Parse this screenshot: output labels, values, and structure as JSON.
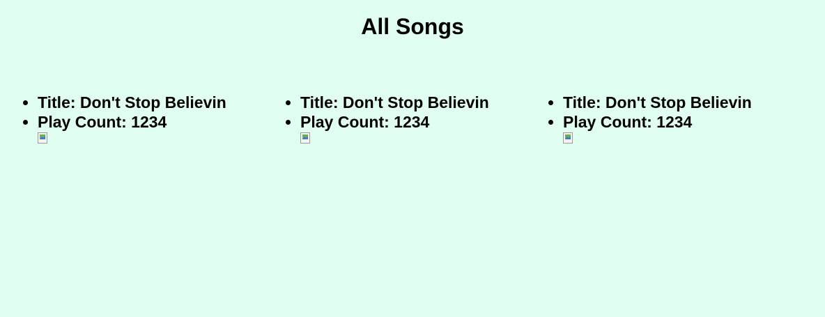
{
  "page": {
    "title": "All Songs"
  },
  "songs": [
    {
      "title_text": "Title: Don't Stop Believin",
      "play_count_text": "Play Count: 1234",
      "image_icon": "broken-image-icon"
    },
    {
      "title_text": "Title: Don't Stop Believin",
      "play_count_text": "Play Count: 1234",
      "image_icon": "broken-image-icon"
    },
    {
      "title_text": "Title: Don't Stop Believin",
      "play_count_text": "Play Count: 1234",
      "image_icon": "broken-image-icon"
    }
  ],
  "colors": {
    "background": "#e0fff0",
    "text": "#000000"
  }
}
